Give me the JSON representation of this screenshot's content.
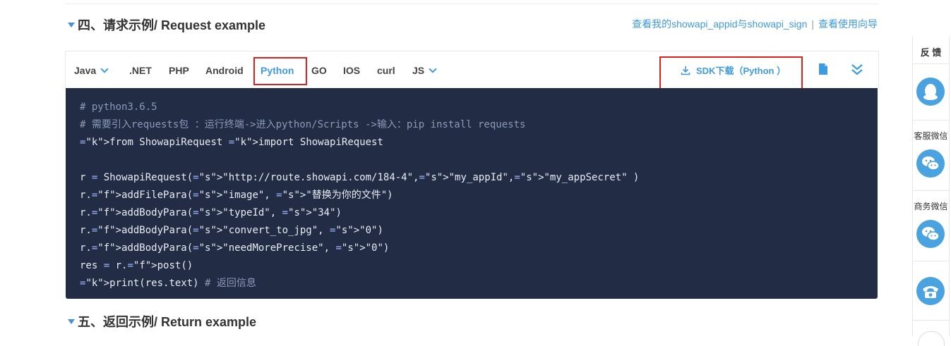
{
  "section4": {
    "title": "四、请求示例/ Request example"
  },
  "section5": {
    "title": "五、返回示例/ Return example"
  },
  "top_links": {
    "appid_link": "查看我的showapi_appid与showapi_sign",
    "separator": "|",
    "guide_link": "查看使用向导"
  },
  "tabs": [
    {
      "label": "Java",
      "dropdown": true
    },
    {
      "label": ".NET"
    },
    {
      "label": "PHP"
    },
    {
      "label": "Android"
    },
    {
      "label": "Python",
      "active": true
    },
    {
      "label": "GO"
    },
    {
      "label": "IOS"
    },
    {
      "label": "curl"
    },
    {
      "label": "JS",
      "dropdown": true
    }
  ],
  "sdk_download": {
    "label": "SDK下载（Python ）",
    "icon": "download-icon"
  },
  "toolbar_icons": [
    "document-icon",
    "double-chevron-down-icon"
  ],
  "code": {
    "language": "python",
    "lines": [
      "# python3.6.5",
      "# 需要引入requests包 ：运行终端->进入python/Scripts ->输入：pip install requests",
      "from ShowapiRequest import ShowapiRequest",
      "",
      "r = ShowapiRequest(\"http://route.showapi.com/184-4\",\"my_appId\",\"my_appSecret\" )",
      "r.addFilePara(\"image\", \"替换为你的文件\")",
      "r.addBodyPara(\"typeId\", \"34\")",
      "r.addBodyPara(\"convert_to_jpg\", \"0\")",
      "r.addBodyPara(\"needMorePrecise\", \"0\")",
      "res = r.post()",
      "print(res.text) # 返回信息"
    ]
  },
  "sidebar": {
    "feedback": "反 馈",
    "items": [
      {
        "icon": "qq-icon"
      },
      {
        "label": "客服微信",
        "icon": "wechat-icon"
      },
      {
        "label": "商务微信",
        "icon": "wechat-icon"
      },
      {
        "icon": "phone-icon"
      }
    ]
  },
  "colors": {
    "accent": "#3f9be0",
    "code_bg": "#232c45",
    "highlight": "#e0201b"
  }
}
